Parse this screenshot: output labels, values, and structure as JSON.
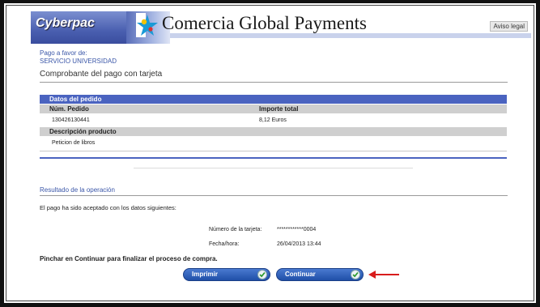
{
  "header": {
    "cyberpac_logo": "Cyberpac",
    "brand_name": "Comercia Global Payments",
    "aviso_legal": "Aviso legal"
  },
  "beneficiary": {
    "label": "Pago a favor de:",
    "name": "SERVICIO UNIVERSIDAD"
  },
  "receipt_title": "Comprobante del pago con tarjeta",
  "order": {
    "section_title": "Datos del pedido",
    "col_order_number": "Núm. Pedido",
    "col_total": "Importe total",
    "order_number": "130426130441",
    "total": "8,12 Euros",
    "product_header": "Descripción producto",
    "product": "Peticion de libros"
  },
  "result": {
    "title": "Resultado de la operación",
    "message": "El pago ha sido aceptado con los datos siguientes:",
    "card_label": "Número de la tarjeta:",
    "card_value": "************0004",
    "date_label": "Fecha/hora:",
    "date_value": "26/04/2013  13:44"
  },
  "instruction": "Pinchar en Continuar para finalizar el proceso de compra.",
  "buttons": {
    "print": "Imprimir",
    "continue": "Continuar"
  },
  "colors": {
    "accent_blue": "#4a63c0",
    "arrow_red": "#d81c1c"
  }
}
